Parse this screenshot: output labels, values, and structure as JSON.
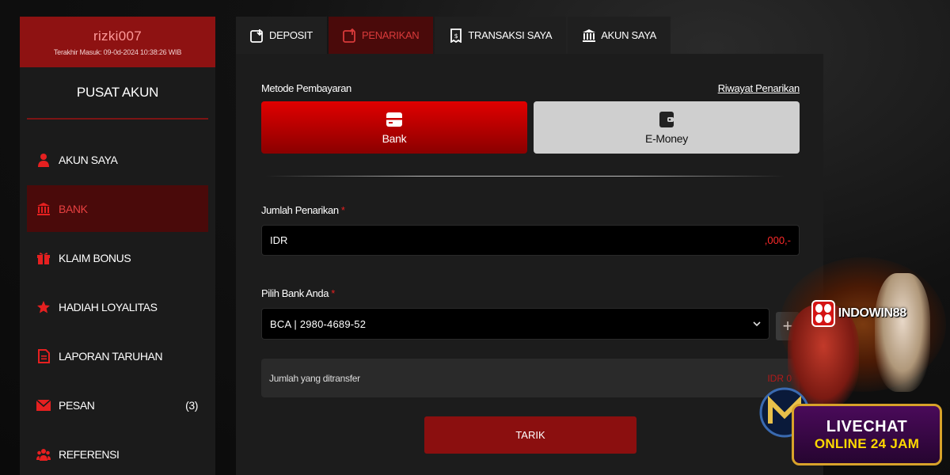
{
  "sidebar": {
    "username": "rizki007",
    "last_login": "Terakhir Masuk: 09-0d-2024 10:38:26 WIB",
    "title": "PUSAT AKUN",
    "items": [
      {
        "label": "AKUN SAYA",
        "icon": "user-icon"
      },
      {
        "label": "BANK",
        "icon": "bank-icon",
        "active": true
      },
      {
        "label": "KLAIM BONUS",
        "icon": "gift-icon"
      },
      {
        "label": "HADIAH LOYALITAS",
        "icon": "star-icon"
      },
      {
        "label": "LAPORAN TARUHAN",
        "icon": "report-icon"
      },
      {
        "label": "PESAN",
        "icon": "mail-icon",
        "count": "(3)"
      },
      {
        "label": "REFERENSI",
        "icon": "group-icon"
      }
    ]
  },
  "tabs": [
    {
      "label": "DEPOSIT",
      "icon": "deposit-icon"
    },
    {
      "label": "PENARIKAN",
      "icon": "withdraw-icon",
      "active": true
    },
    {
      "label": "TRANSAKSI SAYA",
      "icon": "receipt-icon"
    },
    {
      "label": "AKUN SAYA",
      "icon": "bank-icon"
    }
  ],
  "form": {
    "metode_label": "Metode Pembayaran",
    "history_link": "Riwayat Penarikan",
    "method_bank": "Bank",
    "method_emoney": "E-Money",
    "amount_label": "Jumlah Penarikan",
    "required_mark": "*",
    "currency": "IDR",
    "amount_suffix": ",000,-",
    "bank_label": "Pilih Bank Anda",
    "bank_selected": "BCA | 2980-4689-52",
    "add_symbol": "+",
    "transfer_label": "Jumlah yang ditransfer",
    "transfer_value": "IDR 0",
    "submit_label": "TARIK"
  },
  "promo": {
    "brand": "INDOWIN88",
    "live_line1": "LIVECHAT",
    "live_line2": "ONLINE 24 JAM"
  },
  "colors": {
    "accent": "#8b0f0f",
    "active_bg": "#4a0a0a",
    "active_text": "#d83a3a",
    "panel_bg": "#1c1c1c"
  }
}
